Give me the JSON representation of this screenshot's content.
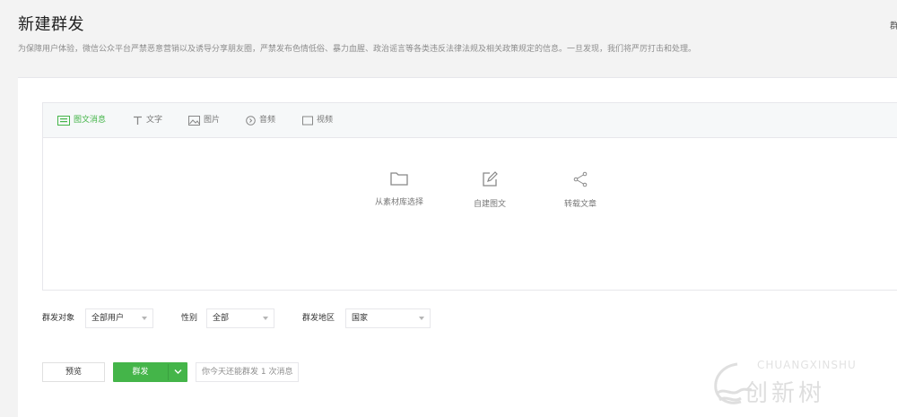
{
  "page": {
    "title": "新建群发",
    "top_right_mark": "群",
    "notice": "为保障用户体验，微信公众平台严禁恶意营销以及诱导分享朋友圈，严禁发布色情低俗、暴力血腥、政治谣言等各类违反法律法规及相关政策规定的信息。一旦发现，我们将严厉打击和处理。"
  },
  "tabs": [
    {
      "label": "图文消息",
      "icon": "news-icon",
      "active": true
    },
    {
      "label": "文字",
      "icon": "text-icon",
      "active": false
    },
    {
      "label": "图片",
      "icon": "image-icon",
      "active": false
    },
    {
      "label": "音频",
      "icon": "audio-icon",
      "active": false
    },
    {
      "label": "视频",
      "icon": "video-icon",
      "active": false
    }
  ],
  "actions": [
    {
      "label": "从素材库选择",
      "icon": "folder-icon"
    },
    {
      "label": "自建图文",
      "icon": "edit-icon"
    },
    {
      "label": "转载文章",
      "icon": "share-icon"
    }
  ],
  "filters": {
    "target_label": "群发对象",
    "target_value": "全部用户",
    "gender_label": "性别",
    "gender_value": "全部",
    "region_label": "群发地区",
    "region_value": "国家"
  },
  "footer": {
    "preview_label": "预览",
    "send_label": "群发",
    "quota_text": "你今天还能群发 1 次消息"
  },
  "watermark": {
    "text_en": "CHUANGXINSHU",
    "text_cn": "创新树"
  },
  "colors": {
    "accent": "#44b549",
    "background": "#f3f3f3",
    "border": "#e7e7eb"
  }
}
